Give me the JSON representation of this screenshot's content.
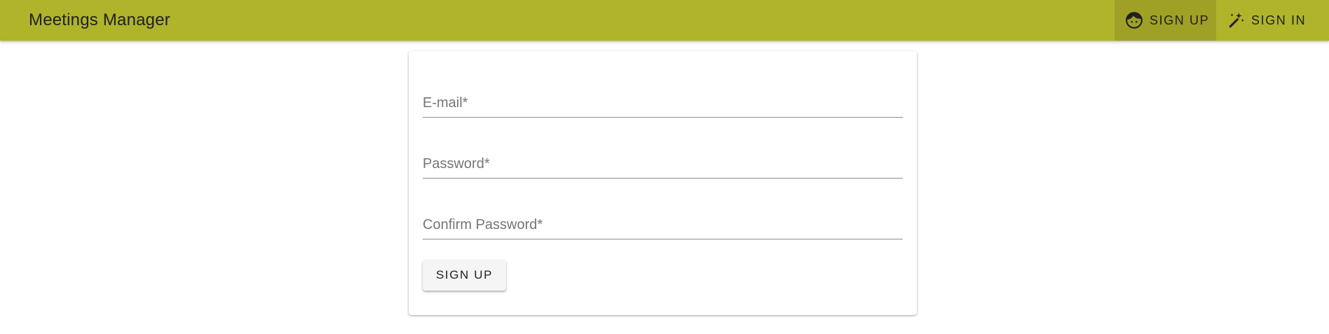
{
  "app": {
    "title": "Meetings Manager",
    "accent_color": "#afb42b"
  },
  "nav": {
    "signup": {
      "label": "SIGN UP",
      "icon": "face-icon",
      "active": true
    },
    "signin": {
      "label": "SIGN IN",
      "icon": "magic-wand-icon",
      "active": false
    }
  },
  "form": {
    "email": {
      "label": "E-mail*",
      "value": ""
    },
    "password": {
      "label": "Password*",
      "value": ""
    },
    "confirm_password": {
      "label": "Confirm Password*",
      "value": ""
    },
    "submit_label": "SIGN UP"
  }
}
